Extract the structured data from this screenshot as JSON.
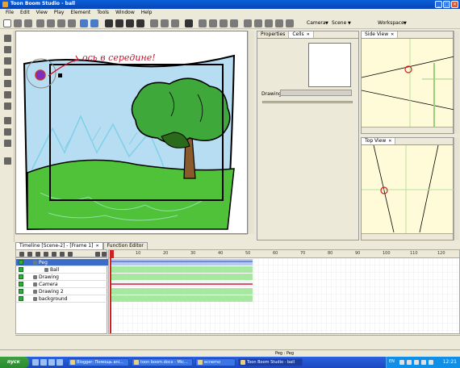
{
  "window": {
    "title": "Toon Boom Studio - ball"
  },
  "menu": [
    "File",
    "Edit",
    "View",
    "Play",
    "Element",
    "Tools",
    "Window",
    "Help"
  ],
  "toolbar": {
    "camera_label": "Camera",
    "scene_label": "Scene",
    "workspace_label": "Workspace"
  },
  "canvas": {
    "annotation_text": "ось в середине!"
  },
  "properties_panel": {
    "tabs": [
      {
        "label": "Properties"
      },
      {
        "label": "Cells"
      }
    ],
    "drawing_label": "Drawing:"
  },
  "side_view": {
    "tab": "Side View"
  },
  "top_view": {
    "tab": "Top View"
  },
  "timeline": {
    "tab_timeline": "Timeline [Scene-2] - [Frame 1]",
    "tab_function": "Function Editor",
    "ruler": [
      "10",
      "20",
      "30",
      "40",
      "50",
      "60",
      "70",
      "80",
      "90",
      "100",
      "110",
      "120"
    ],
    "layers": [
      {
        "name": "Peg"
      },
      {
        "name": "Ball"
      },
      {
        "name": "Drawing"
      },
      {
        "name": "Camera"
      },
      {
        "name": "Drawing 2"
      },
      {
        "name": "background"
      }
    ]
  },
  "status": {
    "text": "Peg : Peg"
  },
  "taskbar": {
    "start_label": "пуск",
    "tasks": [
      "Blogger: Помощь ani...",
      "toon boom.docx - Mic...",
      "ecnemo",
      "Toon Boom Studio - ball"
    ],
    "lang": "EN",
    "clock": "12:21"
  }
}
